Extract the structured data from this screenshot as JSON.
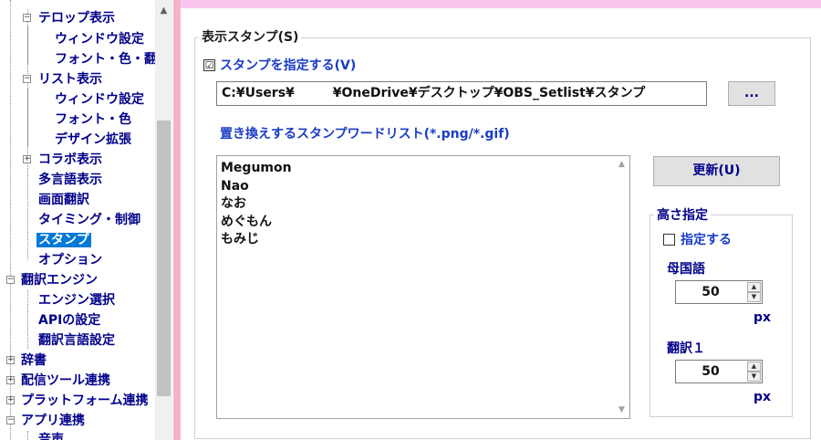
{
  "tree": {
    "items": [
      {
        "label": "テロップ表示",
        "expander": "−"
      },
      {
        "label": "ウィンドウ設定"
      },
      {
        "label": "フォント・色・翻訳"
      },
      {
        "label": "リスト表示",
        "expander": "−"
      },
      {
        "label": "ウィンドウ設定"
      },
      {
        "label": "フォント・色"
      },
      {
        "label": "デザイン拡張"
      },
      {
        "label": "コラボ表示",
        "expander": "+"
      },
      {
        "label": "多言語表示"
      },
      {
        "label": "画面翻訳"
      },
      {
        "label": "タイミング・制御"
      },
      {
        "label": "スタンプ",
        "selected": true
      },
      {
        "label": "オプション"
      },
      {
        "label": "翻訳エンジン",
        "expander": "−"
      },
      {
        "label": "エンジン選択"
      },
      {
        "label": "APIの設定"
      },
      {
        "label": "翻訳言語設定"
      },
      {
        "label": "辞書",
        "expander": "+"
      },
      {
        "label": "配信ツール連携",
        "expander": "+"
      },
      {
        "label": "プラットフォーム連携",
        "expander": "+"
      },
      {
        "label": "アプリ連携",
        "expander": "−"
      },
      {
        "label": "音声"
      }
    ],
    "scroll_up_icon": "▲"
  },
  "stamp_group": {
    "title": "表示スタンプ(S)",
    "enable_checkbox": {
      "label": "スタンプを指定する(V)",
      "checked": true,
      "mark": "☑"
    },
    "path_value": "C:¥Users¥　　　¥OneDrive¥デスクトップ¥OBS_Setlist¥スタンプ",
    "browse_label": "...",
    "wordlist_label": "置き換えするスタンプワードリスト(*.png/*.gif)",
    "wordlist": [
      "Megumon",
      "Nao",
      "なお",
      "めぐもん",
      "もみじ"
    ],
    "list_up_icon": "▲",
    "list_down_icon": "▼",
    "update_label": "更新(U)"
  },
  "height_group": {
    "title": "高さ指定",
    "specify_checkbox": {
      "label": "指定する",
      "checked": false,
      "mark": ""
    },
    "native": {
      "label": "母国語",
      "value": "50",
      "unit": "px"
    },
    "translation": {
      "label": "翻訳１",
      "value": "50",
      "unit": "px"
    },
    "spin_up_icon": "▲",
    "spin_down_icon": "▼"
  },
  "colors": {
    "accent_pink": "#f6b3c6",
    "selected_blue": "#0078d7",
    "label_navy": "#00008b"
  }
}
